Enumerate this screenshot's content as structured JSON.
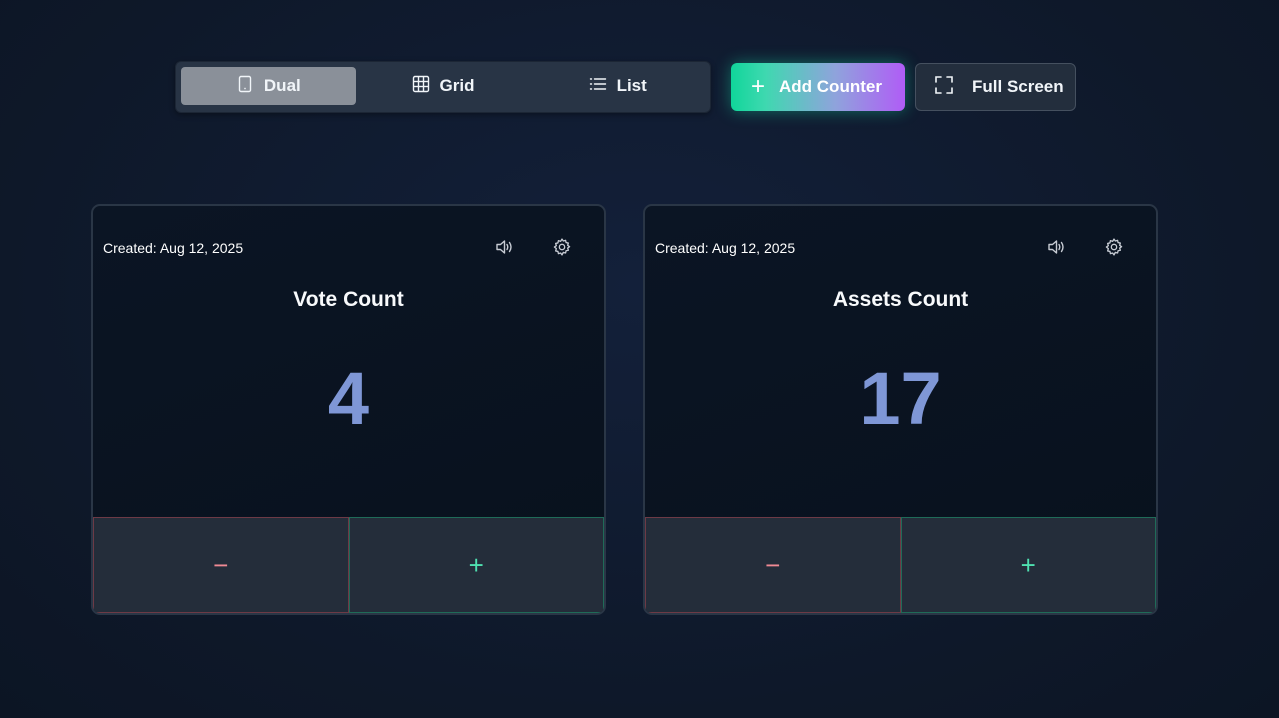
{
  "view_switch": {
    "dual": "Dual",
    "grid": "Grid",
    "list": "List",
    "active": "Dual"
  },
  "actions": {
    "add_counter": "Add Counter",
    "add_icon": "+",
    "full_screen": "Full Screen"
  },
  "counters": [
    {
      "created": "Created: Aug 12, 2025",
      "title": "Vote Count",
      "value": "4",
      "decrement": "−",
      "increment": "+"
    },
    {
      "created": "Created: Aug 12, 2025",
      "title": "Assets Count",
      "value": "17",
      "decrement": "−",
      "increment": "+"
    }
  ],
  "colors": {
    "background": "#0f1a2b",
    "counter_value": "#7f97d6",
    "increment": "#4fe0b0",
    "decrement": "#f08a94",
    "accent_start": "#10d69a",
    "accent_end": "#b05cf6"
  },
  "icons": {
    "dual": "tablet-icon",
    "grid": "grid-icon",
    "list": "list-icon",
    "full_screen": "fullscreen-icon",
    "sound": "speaker-icon",
    "settings": "gear-icon"
  }
}
